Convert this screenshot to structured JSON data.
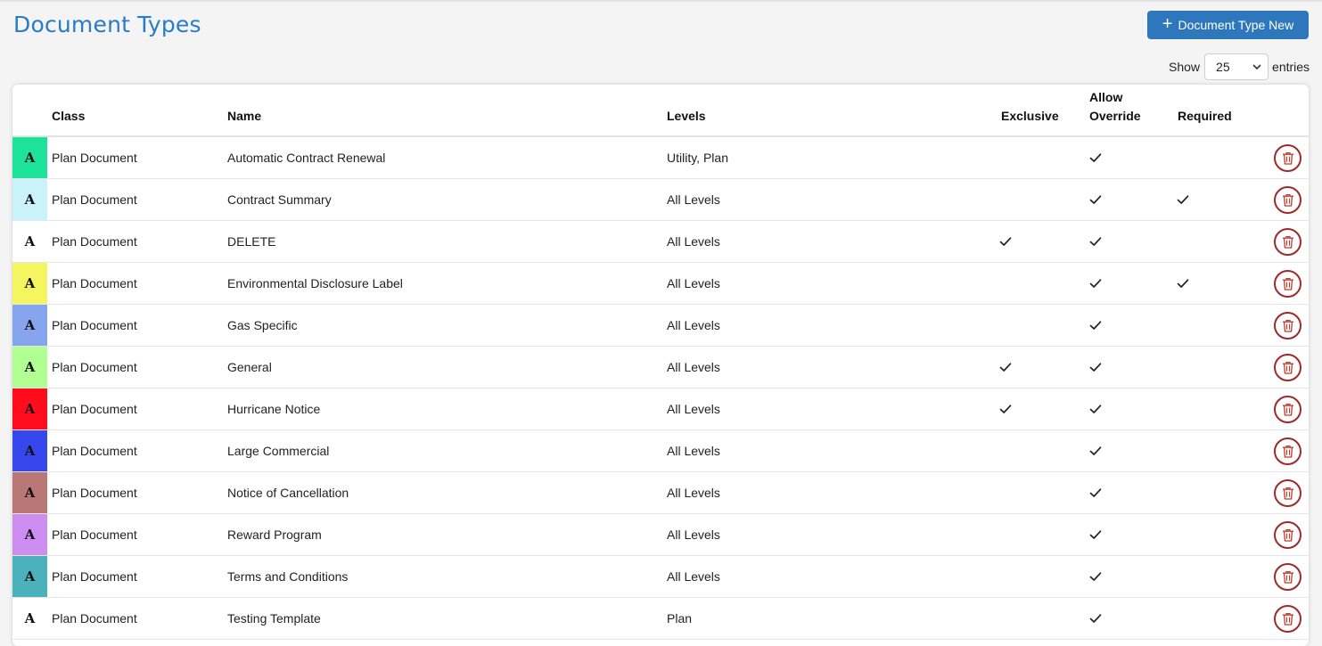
{
  "page": {
    "title": "Document Types",
    "new_button_label": "Document Type New",
    "show_label": "Show",
    "entries_label": "entries",
    "page_size": "25"
  },
  "table": {
    "headers": {
      "class": "Class",
      "name": "Name",
      "levels": "Levels",
      "exclusive": "Exclusive",
      "allow_override_line1": "Allow",
      "allow_override_line2": "Override",
      "required": "Required"
    },
    "swatch_letter": "A",
    "rows": [
      {
        "color": "#1de39a",
        "class": "Plan Document",
        "name": "Automatic Contract Renewal",
        "levels": "Utility, Plan",
        "exclusive": false,
        "allow_override": true,
        "required": false
      },
      {
        "color": "#c9f3f8",
        "class": "Plan Document",
        "name": "Contract Summary",
        "levels": "All Levels",
        "exclusive": false,
        "allow_override": true,
        "required": true
      },
      {
        "color": "#ffffff",
        "class": "Plan Document",
        "name": "DELETE",
        "levels": "All Levels",
        "exclusive": true,
        "allow_override": true,
        "required": false
      },
      {
        "color": "#f5f55f",
        "class": "Plan Document",
        "name": "Environmental Disclosure Label",
        "levels": "All Levels",
        "exclusive": false,
        "allow_override": true,
        "required": true
      },
      {
        "color": "#87a4ee",
        "class": "Plan Document",
        "name": "Gas Specific",
        "levels": "All Levels",
        "exclusive": false,
        "allow_override": true,
        "required": false
      },
      {
        "color": "#b1ff93",
        "class": "Plan Document",
        "name": "General",
        "levels": "All Levels",
        "exclusive": true,
        "allow_override": true,
        "required": false
      },
      {
        "color": "#ff0d1c",
        "class": "Plan Document",
        "name": "Hurricane Notice",
        "levels": "All Levels",
        "exclusive": true,
        "allow_override": true,
        "required": false
      },
      {
        "color": "#3647ee",
        "class": "Plan Document",
        "name": "Large Commercial",
        "levels": "All Levels",
        "exclusive": false,
        "allow_override": true,
        "required": false
      },
      {
        "color": "#b97876",
        "class": "Plan Document",
        "name": "Notice of Cancellation",
        "levels": "All Levels",
        "exclusive": false,
        "allow_override": true,
        "required": false
      },
      {
        "color": "#ce8df0",
        "class": "Plan Document",
        "name": "Reward Program",
        "levels": "All Levels",
        "exclusive": false,
        "allow_override": true,
        "required": false
      },
      {
        "color": "#4bb2bb",
        "class": "Plan Document",
        "name": "Terms and Conditions",
        "levels": "All Levels",
        "exclusive": false,
        "allow_override": true,
        "required": false
      },
      {
        "color": "#ffffff",
        "class": "Plan Document",
        "name": "Testing Template",
        "levels": "Plan",
        "exclusive": false,
        "allow_override": true,
        "required": false
      }
    ]
  },
  "icons": {
    "new": "plus-icon",
    "select_arrow": "chevron-down-icon",
    "check": "check-icon",
    "delete": "trash-icon"
  },
  "colors": {
    "accent": "#2f77bd",
    "title": "#2a7bc6",
    "delete": "#9c2b2b"
  }
}
